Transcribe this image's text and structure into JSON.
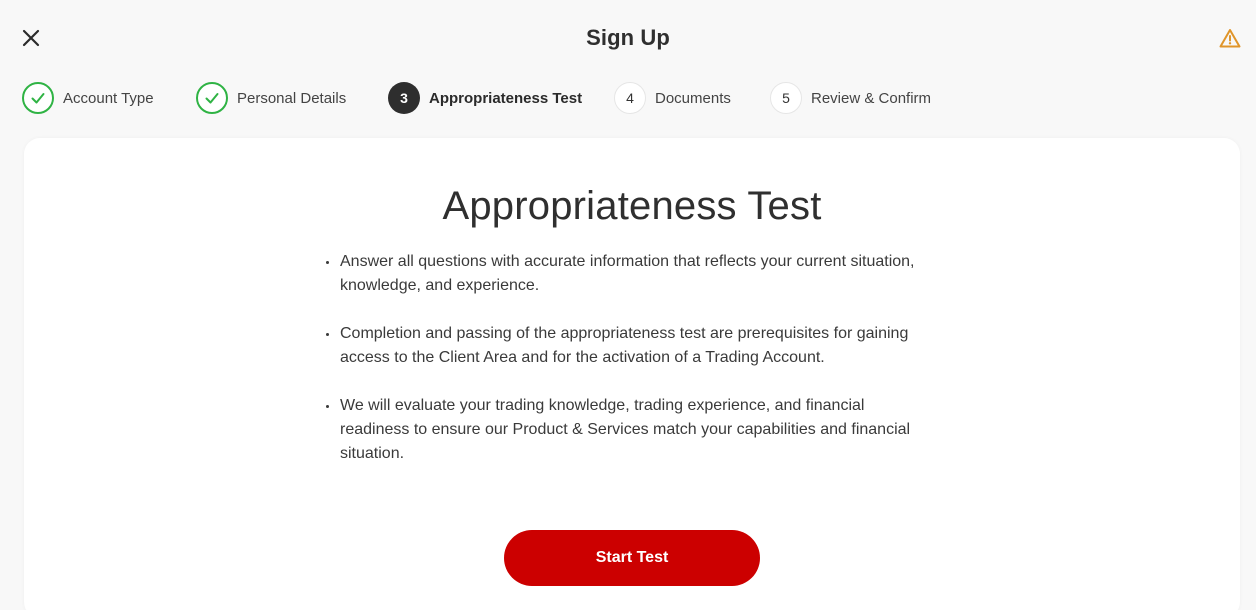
{
  "header": {
    "title": "Sign Up",
    "close_icon": "close-icon",
    "warning_icon": "warning-icon"
  },
  "stepper": {
    "steps": [
      {
        "number": "1",
        "label": "Account Type",
        "status": "done"
      },
      {
        "number": "2",
        "label": "Personal Details",
        "status": "done"
      },
      {
        "number": "3",
        "label": "Appropriateness Test",
        "status": "current"
      },
      {
        "number": "4",
        "label": "Documents",
        "status": "todo"
      },
      {
        "number": "5",
        "label": "Review & Confirm",
        "status": "todo"
      }
    ]
  },
  "main": {
    "title": "Appropriateness Test",
    "bullets": [
      "Answer all questions with accurate information that reflects your current situation, knowledge, and experience.",
      "Completion and passing of the appropriateness test are prerequisites for gaining access to the Client Area and for the activation of a Trading Account.",
      "We will evaluate your trading knowledge, trading experience, and financial readiness to ensure our Product & Services match your capabilities and financial situation."
    ],
    "start_button_label": "Start Test"
  },
  "colors": {
    "accent": "#cc0000",
    "done": "#2fb344",
    "current": "#2e2e2e",
    "warning": "#e0952a"
  }
}
